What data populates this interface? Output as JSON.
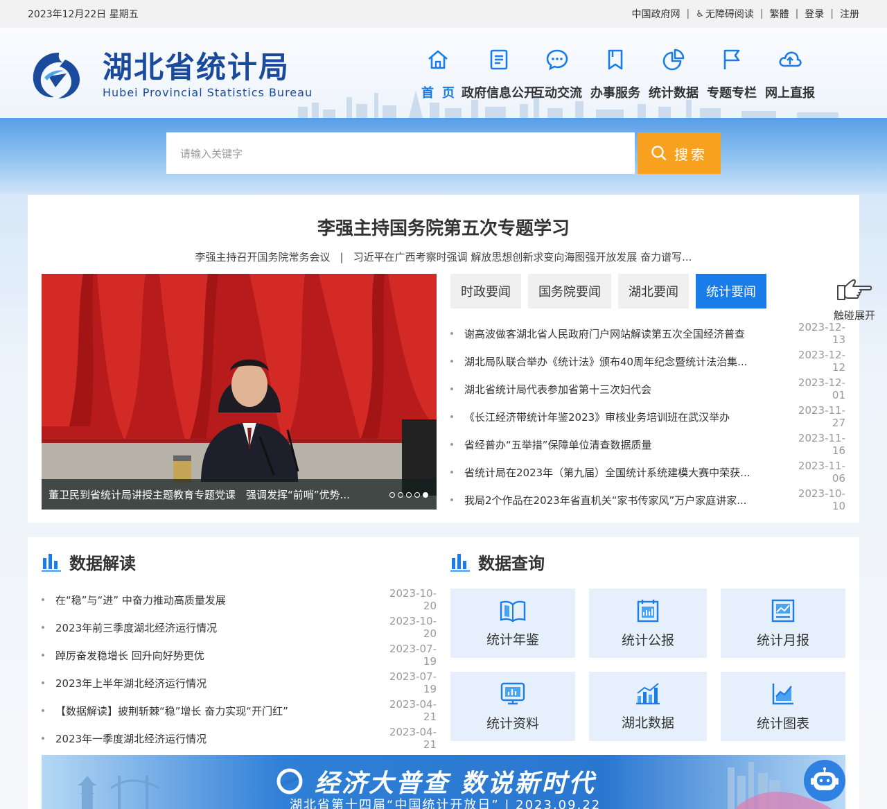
{
  "topbar": {
    "date": "2023年12月22日 星期五",
    "links": [
      "中国政府网",
      "无障碍阅读",
      "繁體",
      "登录",
      "注册"
    ]
  },
  "logo": {
    "cn": "湖北省统计局",
    "en": "Hubei Provincial Statistics Bureau"
  },
  "nav": [
    {
      "label": "首页",
      "icon": "home-icon"
    },
    {
      "label": "政府信息公开",
      "icon": "document-icon"
    },
    {
      "label": "互动交流",
      "icon": "chat-icon"
    },
    {
      "label": "办事服务",
      "icon": "bookmark-icon"
    },
    {
      "label": "统计数据",
      "icon": "pie-chart-icon"
    },
    {
      "label": "专题专栏",
      "icon": "flag-icon"
    },
    {
      "label": "网上直报",
      "icon": "cloud-upload-icon"
    }
  ],
  "search": {
    "placeholder": "请输入关键字",
    "button": "搜索"
  },
  "headline": {
    "title": "李强主持国务院第五次专题学习",
    "sub1": "李强主持召开国务院常务会议",
    "sub2": "习近平在广西考察时强调 解放思想创新求变向海图强开放发展 奋力谱写..."
  },
  "photo": {
    "caption": "董卫民到省统计局讲授主题教育专题党课　强调发挥“前哨”优势...",
    "dots": 5,
    "active_dot": 5
  },
  "tabs": [
    {
      "label": "时政要闻",
      "active": false
    },
    {
      "label": "国务院要闻",
      "active": false
    },
    {
      "label": "湖北要闻",
      "active": false
    },
    {
      "label": "统计要闻",
      "active": true
    }
  ],
  "news": [
    {
      "title": "谢高波做客湖北省人民政府门户网站解读第五次全国经济普查",
      "date": "2023-12-13"
    },
    {
      "title": "湖北局队联合举办《统计法》颁布40周年纪念暨统计法治集...",
      "date": "2023-12-12"
    },
    {
      "title": "湖北省统计局代表参加省第十三次妇代会",
      "date": "2023-12-01"
    },
    {
      "title": "《长江经济带统计年鉴2023》审核业务培训班在武汉举办",
      "date": "2023-11-27"
    },
    {
      "title": "省经普办“五举措”保障单位清查数据质量",
      "date": "2023-11-16"
    },
    {
      "title": "省统计局在2023年（第九届）全国统计系统建模大赛中荣获...",
      "date": "2023-11-06"
    },
    {
      "title": "我局2个作品在2023年省直机关“家书传家风”万户家庭讲家...",
      "date": "2023-10-10"
    }
  ],
  "touch": {
    "label": "触碰展开"
  },
  "interpret": {
    "title": "数据解读",
    "items": [
      {
        "title": "在“稳”与“进” 中奋力推动高质量发展",
        "date": "2023-10-20"
      },
      {
        "title": "2023年前三季度湖北经济运行情况",
        "date": "2023-10-20"
      },
      {
        "title": "踔厉奋发稳增长 回升向好势更优",
        "date": "2023-07-19"
      },
      {
        "title": "2023年上半年湖北经济运行情况",
        "date": "2023-07-19"
      },
      {
        "title": "【数据解读】披荆斩棘“稳”增长 奋力实现“开门红”",
        "date": "2023-04-21"
      },
      {
        "title": "2023年一季度湖北经济运行情况",
        "date": "2023-04-21"
      }
    ]
  },
  "query": {
    "title": "数据查询",
    "items": [
      {
        "label": "统计年鉴",
        "icon": "book-icon"
      },
      {
        "label": "统计公报",
        "icon": "calendar-chart-icon"
      },
      {
        "label": "统计月报",
        "icon": "line-chart-icon"
      },
      {
        "label": "统计资料",
        "icon": "monitor-chart-icon"
      },
      {
        "label": "湖北数据",
        "icon": "bar-chart-icon"
      },
      {
        "label": "统计图表",
        "icon": "area-chart-icon"
      }
    ]
  },
  "banner": {
    "title": "经济大普查 数说新时代",
    "sub": "湖北省第十四届“中国统计开放日” | 2023.09.22"
  },
  "colors": {
    "brand": "#1a4a9c",
    "accent": "#1a7ce8",
    "search_button": "#f8a11e"
  }
}
